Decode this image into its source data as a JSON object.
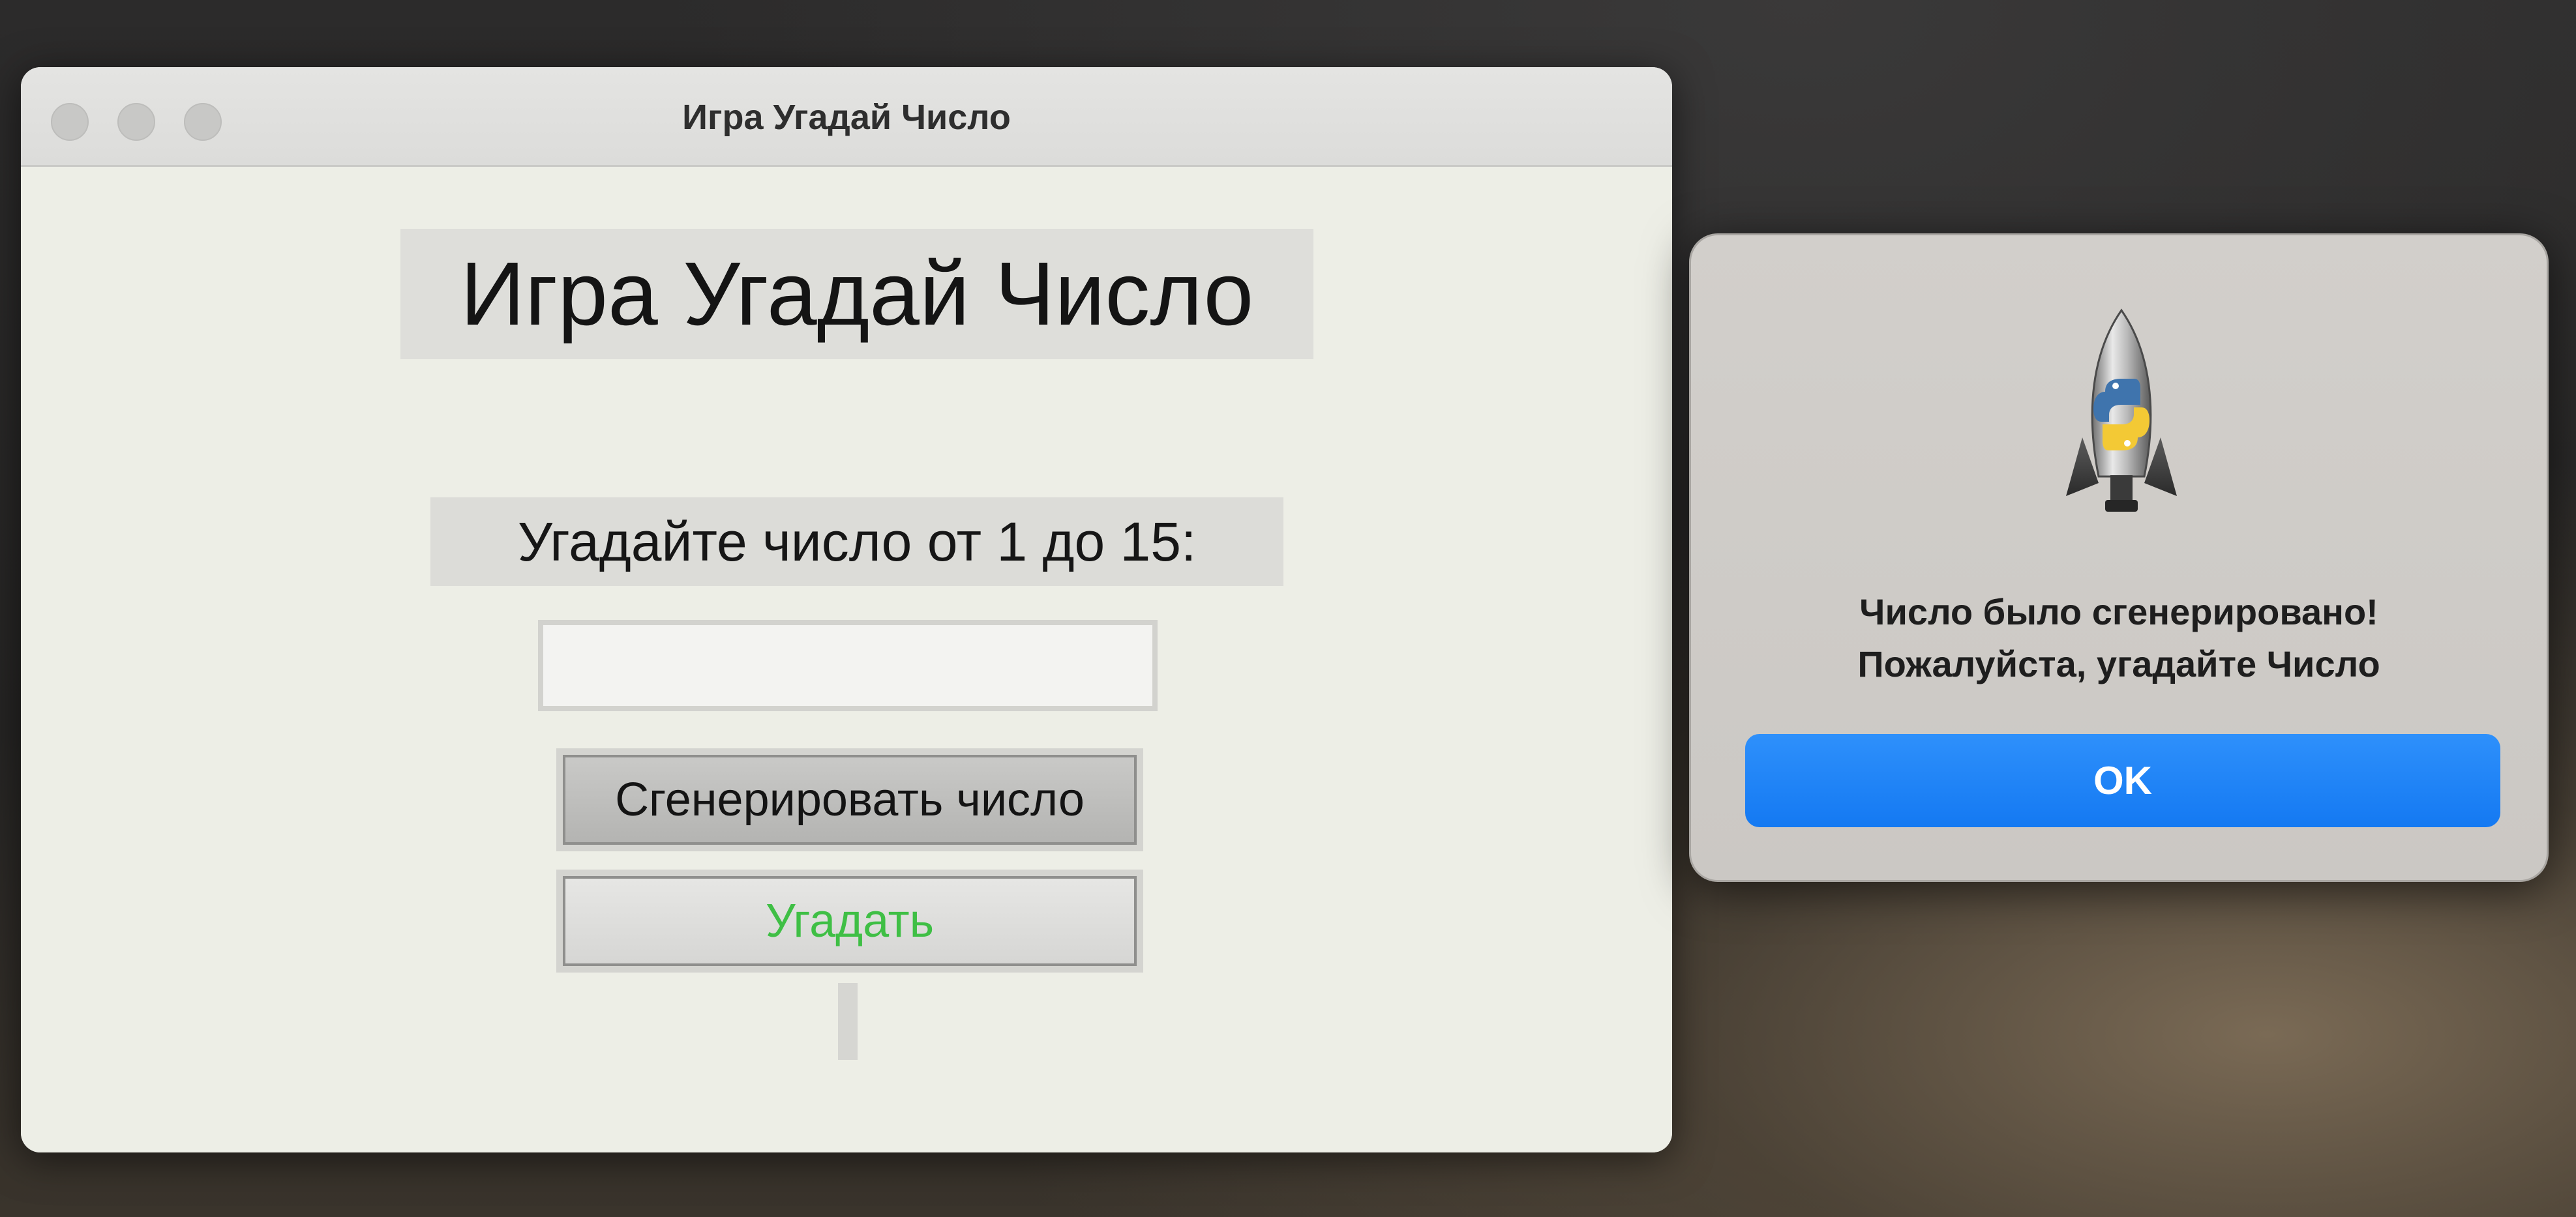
{
  "main_window": {
    "title": "Игра Угадай Число",
    "heading": "Игра Угадай Число",
    "prompt": "Угадайте число от 1 до 15:",
    "guess_input": {
      "value": "",
      "placeholder": ""
    },
    "generate_button_label": "Сгенерировать число",
    "guess_button_label": "Угадать",
    "result_text": ""
  },
  "dialog": {
    "icon": "python-launcher-rocket-icon",
    "message_line1": "Число было сгенерировано!",
    "message_line2": "Пожалуйста, угадайте Число",
    "ok_label": "OK"
  },
  "colors": {
    "window_bg": "#edeee6",
    "guess_button_text": "#3fbf45",
    "ok_button": "#1479f2",
    "dialog_bg": "#cbc8c4"
  }
}
